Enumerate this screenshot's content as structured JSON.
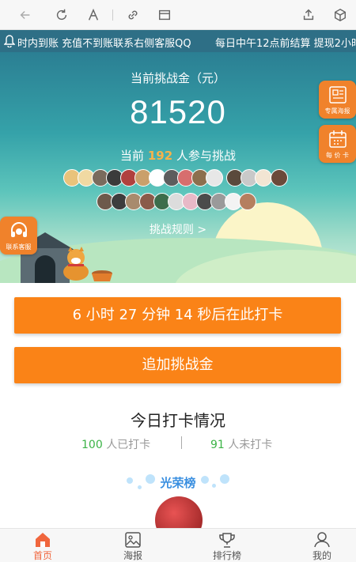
{
  "marquee": {
    "text_left": "时内到账 充值不到账联系右侧客服QQ",
    "text_right": "每日中午12点前结算 提现2小时内"
  },
  "hero": {
    "challenge_label": "当前挑战金（元）",
    "amount": "81520",
    "participants_prefix": "当前",
    "participants_count": "192",
    "participants_suffix": "人参与挑战",
    "rules_link": "挑战规则 >"
  },
  "floating": {
    "poster": "专属海报",
    "calendar": "每 价 卡",
    "service": "联系客服"
  },
  "buttons": {
    "countdown": "6 小时 27 分钟 14 秒后在此打卡",
    "add_funds": "追加挑战金"
  },
  "checkin": {
    "title": "今日打卡情况",
    "checked_count": "100",
    "checked_label": "人已打卡",
    "unchecked_count": "91",
    "unchecked_label": "人未打卡"
  },
  "honor": {
    "title": "光荣榜"
  },
  "nav": {
    "home": "首页",
    "poster": "海报",
    "ranking": "排行榜",
    "mine": "我的"
  },
  "colors": {
    "accent": "#fa8317",
    "active_nav": "#f0663d",
    "green": "#3bb346"
  }
}
